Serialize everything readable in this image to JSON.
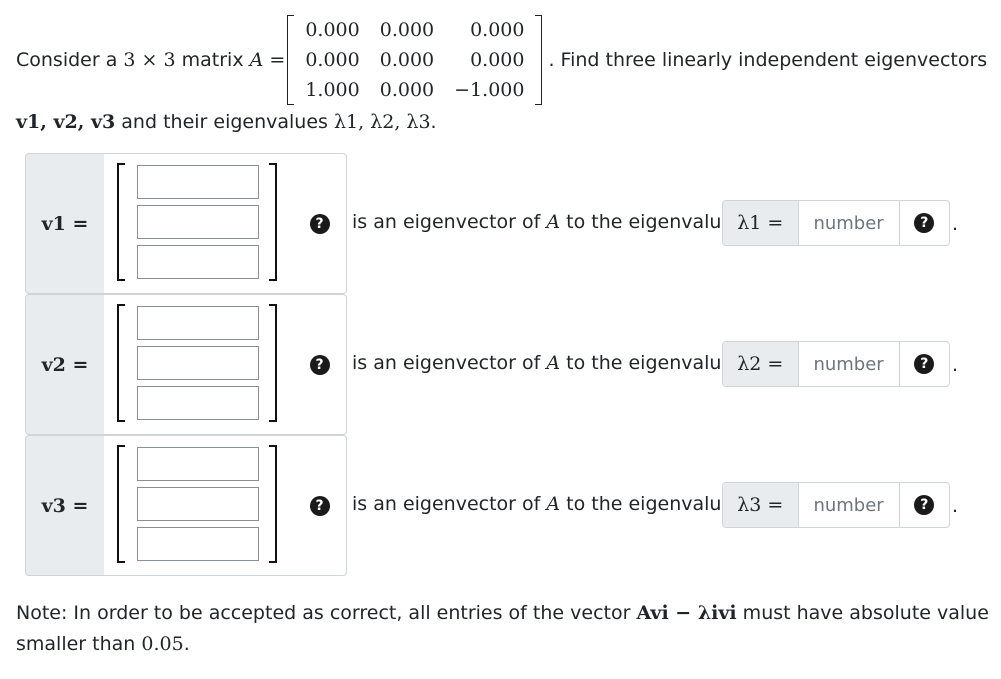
{
  "question": {
    "consider": "Consider a",
    "dims": "3 × 3",
    "matrix_word": "matrix",
    "matrix_name": "A",
    "equals": "=",
    "matrix_rows": [
      [
        "0.000",
        "0.000",
        "0.000"
      ],
      [
        "0.000",
        "0.000",
        "0.000"
      ],
      [
        "1.000",
        "0.000",
        "−1.000"
      ]
    ],
    "find_text": ". Find three linearly independent eigenvectors",
    "line2_vectors": "v1, v2, v3",
    "line2_mid": " and their eigenvalues ",
    "line2_lambdas": "λ1, λ2, λ3",
    "line2_end": "."
  },
  "rows": [
    {
      "vec_label": "v1 =",
      "statement_pre": "is an eigenvector of ",
      "statement_A": "A",
      "statement_post": " to the eigenvalue",
      "lam_label": "λ1 =",
      "lam_placeholder": "number",
      "period": "."
    },
    {
      "vec_label": "v2 =",
      "statement_pre": "is an eigenvector of ",
      "statement_A": "A",
      "statement_post": " to the eigenvalue",
      "lam_label": "λ2 =",
      "lam_placeholder": "number",
      "period": "."
    },
    {
      "vec_label": "v3 =",
      "statement_pre": "is an eigenvector of ",
      "statement_A": "A",
      "statement_post": " to the eigenvalue",
      "lam_label": "λ3 =",
      "lam_placeholder": "number",
      "period": "."
    }
  ],
  "help_icon_glyph": "?",
  "note": {
    "pre": "Note: In order to be accepted as correct, all entries of the vector ",
    "expr": "Avi − λivi",
    "mid": " must have absolute value smaller than ",
    "tol": "0.05",
    "end": "."
  },
  "icons": [
    "help-icon"
  ]
}
